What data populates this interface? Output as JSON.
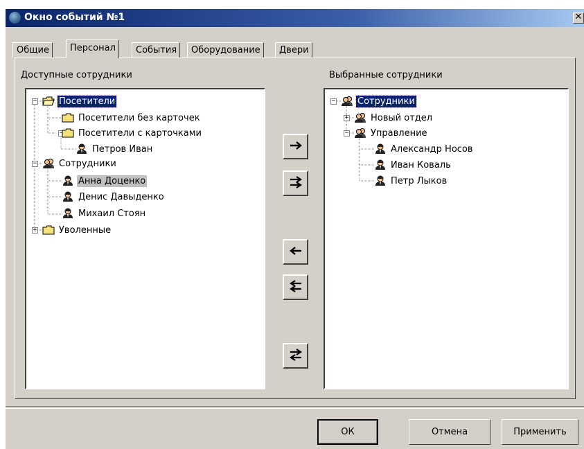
{
  "window": {
    "title": "Окно событий №1",
    "close_glyph": "✕"
  },
  "tabs": [
    {
      "label": "Общие",
      "active": false
    },
    {
      "label": "Персонал",
      "active": true
    },
    {
      "label": "События",
      "active": false
    },
    {
      "label": "Оборудование",
      "active": false
    },
    {
      "label": "Двери",
      "active": false
    }
  ],
  "left_panel": {
    "label": "Доступные сотрудники",
    "nodes": [
      {
        "label": "Посетители",
        "icon": "folder-open-icon",
        "expander": "minus",
        "state": "selected"
      },
      {
        "label": "Посетители без карточек",
        "icon": "folder-icon"
      },
      {
        "label": "Посетители с карточками",
        "icon": "folder-icon",
        "expander": "minus"
      },
      {
        "label": "Петров Иван",
        "icon": "person-icon"
      },
      {
        "label": "Сотрудники",
        "icon": "group-icon",
        "expander": "minus"
      },
      {
        "label": "Анна Доценко",
        "icon": "person-icon",
        "state": "highlighted"
      },
      {
        "label": "Денис Давыденко",
        "icon": "person-icon"
      },
      {
        "label": "Михаил Стоян",
        "icon": "person-icon"
      },
      {
        "label": "Уволенные",
        "icon": "folder-icon",
        "expander": "plus"
      }
    ]
  },
  "right_panel": {
    "label": "Выбранные сотрудники",
    "nodes": [
      {
        "label": "Сотрудники",
        "icon": "group-icon",
        "expander": "minus",
        "state": "selected"
      },
      {
        "label": "Новый отдел",
        "icon": "group-icon",
        "expander": "plus"
      },
      {
        "label": "Управление",
        "icon": "group-icon",
        "expander": "minus"
      },
      {
        "label": "Александр Носов",
        "icon": "person-icon"
      },
      {
        "label": "Иван Коваль",
        "icon": "person-icon"
      },
      {
        "label": "Петр Лыков",
        "icon": "person-icon"
      }
    ]
  },
  "move_buttons": [
    {
      "name": "add-selected-button",
      "icon": "arrow-right-icon"
    },
    {
      "name": "add-all-button",
      "icon": "double-arrow-right-icon"
    },
    {
      "name": "remove-selected-button",
      "icon": "arrow-left-icon"
    },
    {
      "name": "remove-all-button",
      "icon": "double-arrow-left-icon"
    },
    {
      "name": "swap-button",
      "icon": "swap-arrows-icon"
    }
  ],
  "buttons": {
    "ok": "ОК",
    "cancel": "Отмена",
    "apply": "Применить"
  },
  "colors": {
    "selection": "#0a246a",
    "face": "#d4d0c8",
    "highlight": "#c0c0c0",
    "titlebar": "#0a246a"
  }
}
